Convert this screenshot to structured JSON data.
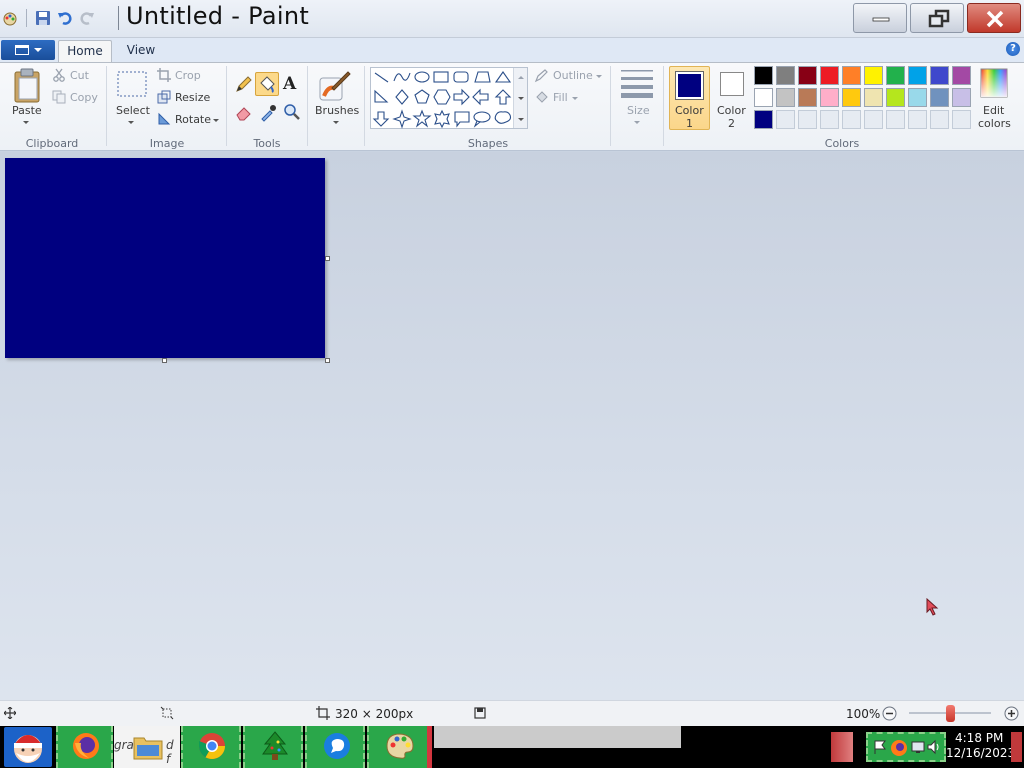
{
  "window": {
    "title": "Untitled - Paint"
  },
  "tabs": [
    {
      "label": "Home"
    },
    {
      "label": "View"
    }
  ],
  "ribbon": {
    "clipboard": {
      "paste": "Paste",
      "cut": "Cut",
      "copy": "Copy",
      "group": "Clipboard"
    },
    "image": {
      "select": "Select",
      "crop": "Crop",
      "resize": "Resize",
      "rotate": "Rotate",
      "group": "Image"
    },
    "tools": {
      "group": "Tools",
      "text_glyph": "A"
    },
    "brushes": {
      "label": "Brushes"
    },
    "shapes": {
      "outline": "Outline",
      "fill": "Fill",
      "group": "Shapes"
    },
    "size": {
      "label": "Size"
    },
    "colors": {
      "color1_label": "Color",
      "color1_num": "1",
      "color2_label": "Color",
      "color2_num": "2",
      "edit_label": "Edit",
      "edit_label2": "colors",
      "group": "Colors",
      "color1": "#000080",
      "color2": "#ffffff",
      "palette_row1": [
        "#000000",
        "#7f7f7f",
        "#880015",
        "#ed1c24",
        "#ff7f27",
        "#fff200",
        "#22b14c",
        "#00a2e8",
        "#3f48cc",
        "#a349a4"
      ],
      "palette_row2": [
        "#ffffff",
        "#c3c3c3",
        "#b97a57",
        "#ffaec9",
        "#ffc90e",
        "#efe4b0",
        "#b5e61d",
        "#99d9ea",
        "#7092be",
        "#c8bfe7"
      ],
      "palette_row3": [
        "#000080"
      ]
    }
  },
  "canvas": {
    "fill_color": "#000080"
  },
  "status": {
    "dimensions": "320 × 200px",
    "zoom": "100%"
  },
  "taskbar": {
    "explorer_label": "gra",
    "explorer_label2": "d f",
    "time": "4:18 PM",
    "date": "12/16/2023"
  }
}
